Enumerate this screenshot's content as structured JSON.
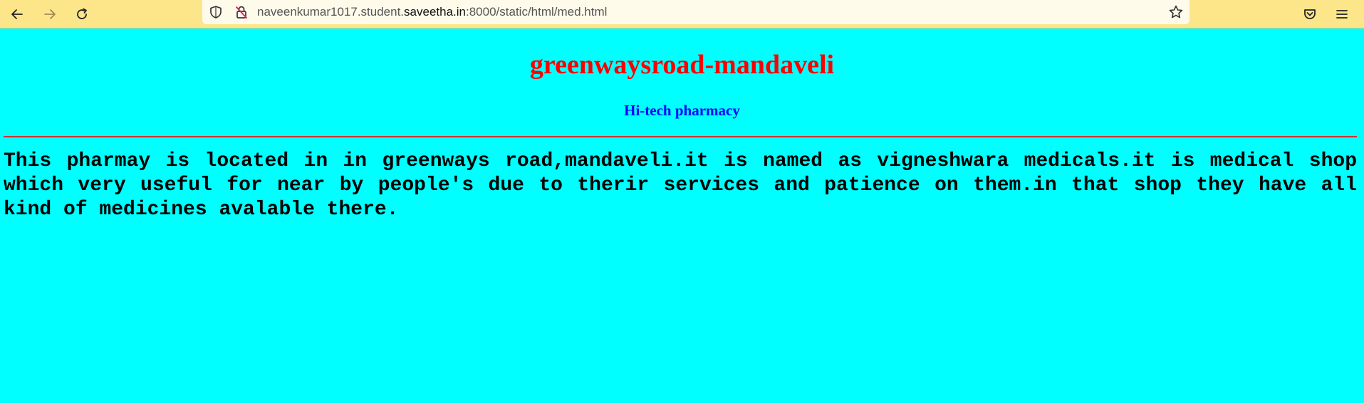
{
  "browser": {
    "url_prefix": "naveenkumar1017.student.",
    "url_domain": "saveetha.in",
    "url_suffix": ":8000/static/html/med.html",
    "icons": {
      "back": "arrow-left-icon",
      "forward": "arrow-right-icon",
      "reload": "reload-icon",
      "shield": "shield-icon",
      "lock": "insecure-lock-icon",
      "bookmark": "star-icon",
      "pocket": "pocket-icon",
      "menu": "hamburger-menu-icon"
    },
    "colors": {
      "toolbar": "#fde68a",
      "urlbar": "#fffbeb"
    }
  },
  "page": {
    "background": "#00ffff",
    "title": "greenwaysroad-mandaveli",
    "title_color": "#ff0000",
    "subtitle": "Hi-tech pharmacy",
    "subtitle_color": "#0000ff",
    "divider_color": "#cc3333",
    "paragraph": "This pharmay is located in in greenways road,mandaveli.it is named as vigneshwara medicals.it is medical shop which very useful for near by people's due to therir services and patience on them.in that shop they have all kind of medicines avalable there."
  }
}
